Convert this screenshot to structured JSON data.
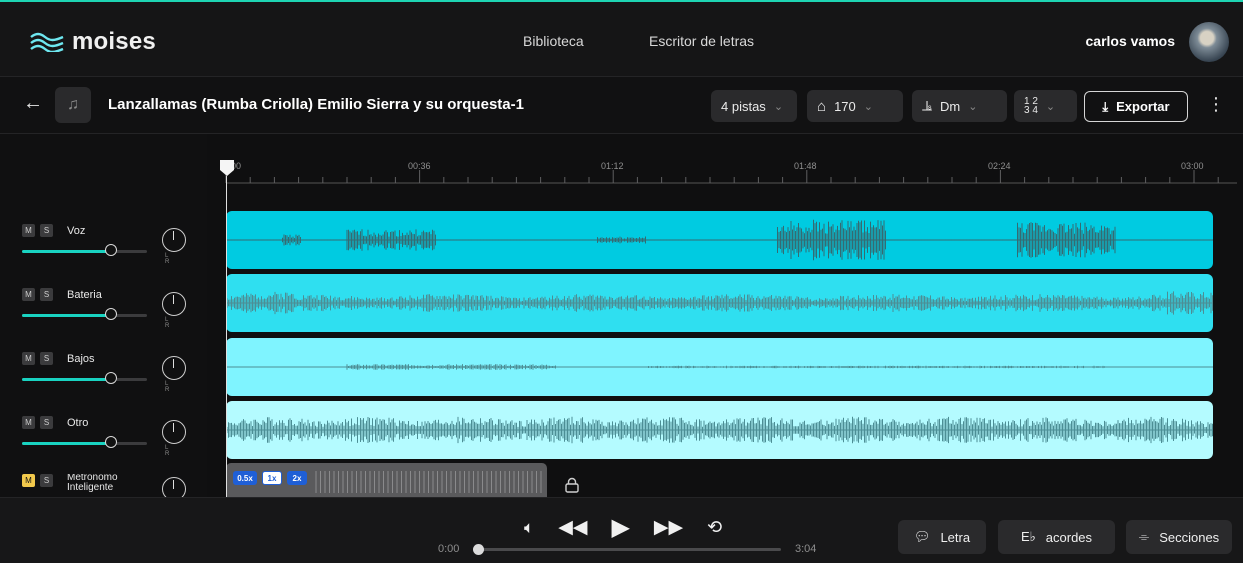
{
  "header": {
    "logo_text": "moises",
    "nav_items": [
      "Biblioteca",
      "Escritor de letras"
    ],
    "user_name": "carlos vamos"
  },
  "toolbar": {
    "song_title": "Lanzallamas (Rumba Criolla) Emilio Sierra y su orquesta-1",
    "tracks_label": "4 pistas",
    "tempo": "170",
    "key": "Dm",
    "export_label": "Exportar"
  },
  "ruler": {
    "ticks": [
      "00",
      "00:36",
      "01:12",
      "01:48",
      "02:24",
      "03:00"
    ]
  },
  "tracks": [
    {
      "mute_label": "M",
      "solo_label": "S",
      "name": "Voz",
      "color": "#00cbe1"
    },
    {
      "mute_label": "M",
      "solo_label": "S",
      "name": "Bateria",
      "color": "#2fdff0"
    },
    {
      "mute_label": "M",
      "solo_label": "S",
      "name": "Bajos",
      "color": "#7ff4ff"
    },
    {
      "mute_label": "M",
      "solo_label": "S",
      "name": "Otro",
      "color": "#b4fbff"
    }
  ],
  "metronome": {
    "mute_label": "M",
    "solo_label": "S",
    "name_line1": "Metrónomo",
    "name_line2": "Inteligente",
    "speed_options": [
      "0.5x",
      "1x",
      "2x"
    ],
    "selected_speed": "1x"
  },
  "player": {
    "current_time": "0:00",
    "duration": "3:04",
    "progress_fraction": 0.0
  },
  "footer_buttons": {
    "lyrics": "Letra",
    "chords": "acordes",
    "sections": "Secciones"
  },
  "colors": {
    "brand_accent": "#1ed4b3",
    "slider_fill": "#19d3c1"
  }
}
